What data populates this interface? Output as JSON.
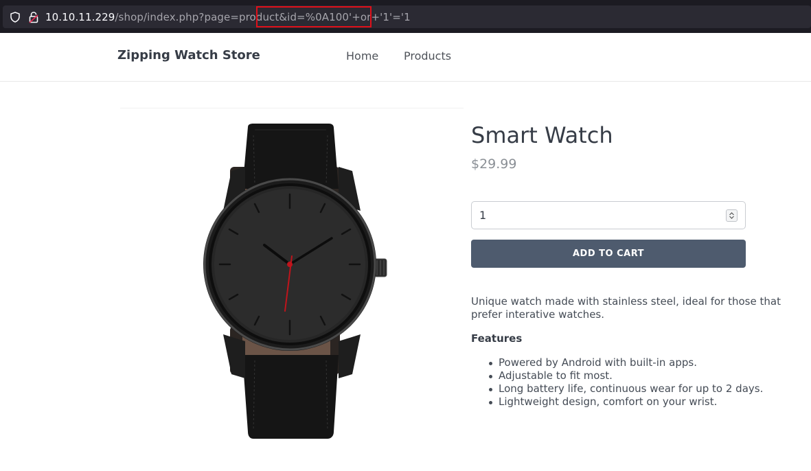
{
  "browser": {
    "url_host": "10.10.11.229",
    "url_rest": "/shop/index.php?page=product&id=%0A100'+or+'1'='1"
  },
  "site": {
    "brand": "Zipping Watch Store",
    "nav": [
      {
        "label": "Home"
      },
      {
        "label": "Products"
      }
    ]
  },
  "product": {
    "title": "Smart Watch",
    "price": "$29.99",
    "quantity": "1",
    "add_to_cart_label": "ADD TO CART",
    "description": "Unique watch made with stainless steel, ideal for those that prefer interative watches.",
    "features_heading": "Features",
    "features": [
      "Powered by Android with built-in apps.",
      "Adjustable to fit most.",
      "Long battery life, continuous wear for up to 2 days.",
      "Lightweight design, comfort on your wrist."
    ]
  },
  "colors": {
    "url_highlight": "#e0101a",
    "button": "#4e5b6e",
    "second_hand": "#c0141c"
  },
  "icons": {
    "shield": "shield-icon",
    "lock": "lock-icon",
    "stepper": "chevron-updown-icon"
  }
}
